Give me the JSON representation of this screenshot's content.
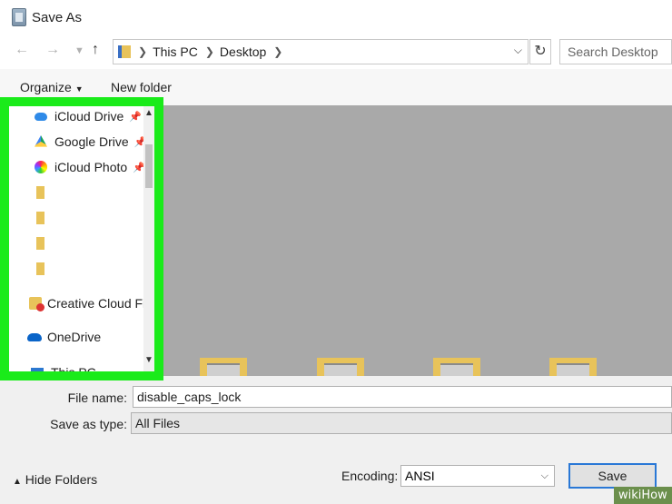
{
  "window": {
    "title": "Save As"
  },
  "address": {
    "segments": [
      "This PC",
      "Desktop"
    ],
    "search_placeholder": "Search Desktop"
  },
  "toolbar": {
    "organize": "Organize",
    "new_folder": "New folder"
  },
  "sidebar": {
    "items": [
      {
        "label": "iCloud Drive",
        "icon": "icloud-icon",
        "pinned": true
      },
      {
        "label": "Google Drive",
        "icon": "google-drive-icon",
        "pinned": true
      },
      {
        "label": "iCloud Photo",
        "icon": "icloud-photos-icon",
        "pinned": true
      },
      {
        "label": "",
        "icon": "folder-icon"
      },
      {
        "label": "",
        "icon": "folder-icon"
      },
      {
        "label": "",
        "icon": "folder-icon"
      },
      {
        "label": "",
        "icon": "folder-icon"
      },
      {
        "label": "Creative Cloud Fil",
        "icon": "creative-cloud-icon"
      },
      {
        "label": "OneDrive",
        "icon": "onedrive-icon"
      },
      {
        "label": "This PC",
        "icon": "this-pc-icon"
      }
    ]
  },
  "form": {
    "file_name_label": "File name:",
    "file_name_value": "disable_caps_lock",
    "save_type_label": "Save as type:",
    "save_type_value": "All Files",
    "hide_folders": "Hide Folders",
    "encoding_label": "Encoding:",
    "encoding_value": "ANSI",
    "save_button": "Save"
  },
  "watermark": "wikiHow",
  "colors": {
    "highlight": "#1aeb1a",
    "accent": "#2a78d6"
  }
}
